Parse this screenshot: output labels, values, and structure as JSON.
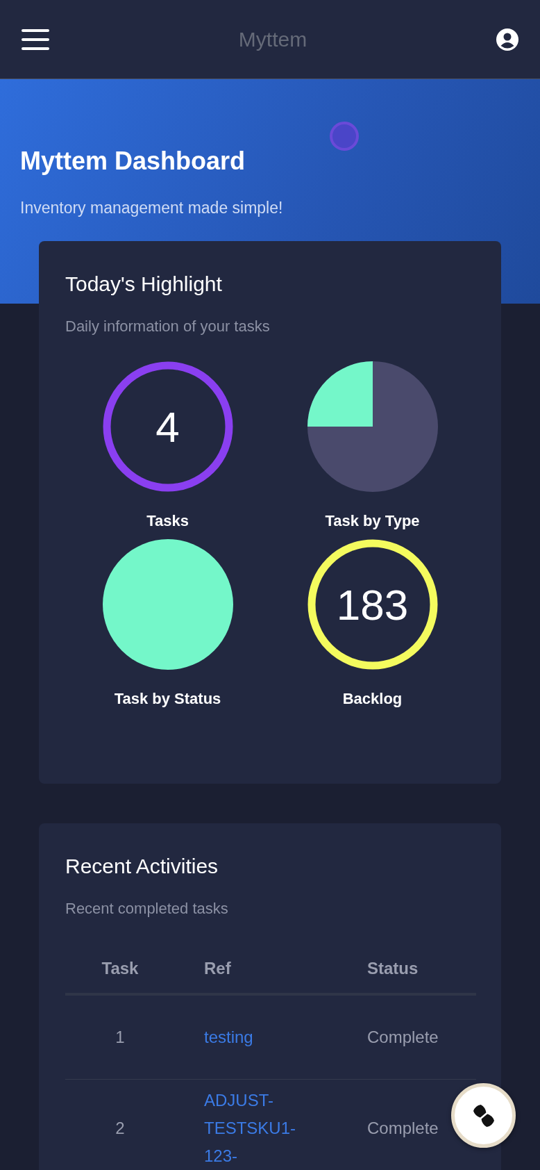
{
  "header": {
    "title": "Myttem"
  },
  "hero": {
    "title": "Myttem Dashboard",
    "subtitle": "Inventory management made simple!"
  },
  "highlight": {
    "title": "Today's Highlight",
    "subtitle": "Daily information of your tasks",
    "charts": [
      {
        "kind": "ring",
        "value": "4",
        "label": "Tasks",
        "color": "#8a3ff0"
      },
      {
        "kind": "pie",
        "label": "Task by Type",
        "color": "#74f7c9"
      },
      {
        "kind": "disc",
        "label": "Task by Status",
        "color": "#74f7c9"
      },
      {
        "kind": "ring",
        "value": "183",
        "label": "Backlog",
        "color": "#f4fb5e"
      }
    ]
  },
  "activities": {
    "title": "Recent Activities",
    "subtitle": "Recent completed tasks",
    "columns": [
      "Task",
      "Ref",
      "Status"
    ],
    "rows": [
      {
        "task": "1",
        "ref": "testing",
        "status": "Complete"
      },
      {
        "task": "2",
        "ref": "ADJUST-TESTSKU1-123-",
        "status": "Complete"
      }
    ]
  }
}
